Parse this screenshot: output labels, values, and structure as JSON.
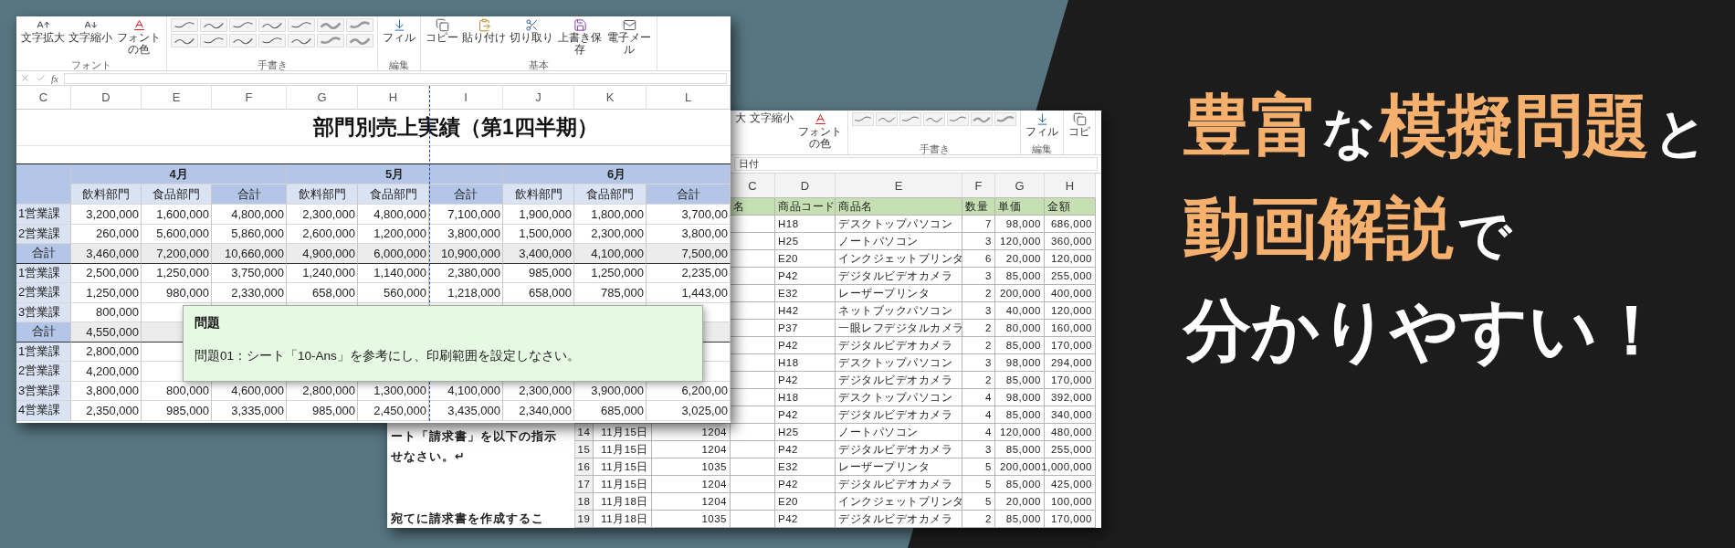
{
  "front_window": {
    "ribbon": {
      "groups": [
        {
          "kind": "tools",
          "label": "フォント",
          "tools": [
            {
              "label": "文字拡大",
              "kind": "grow"
            },
            {
              "label": "文字縮小",
              "kind": "shrink"
            },
            {
              "label": "フォントの色",
              "kind": "font_color"
            }
          ]
        },
        {
          "kind": "gallery",
          "label": "手書き"
        },
        {
          "kind": "tools",
          "label": "編集",
          "tools": [
            {
              "label": "フィル",
              "kind": "fill"
            }
          ]
        },
        {
          "kind": "tools",
          "label": "基本",
          "tools": [
            {
              "label": "コピー",
              "kind": "copy"
            },
            {
              "label": "貼り付け",
              "kind": "paste"
            },
            {
              "label": "切り取り",
              "kind": "cut"
            },
            {
              "label": "上書き保存",
              "kind": "save"
            },
            {
              "label": "電子メール",
              "kind": "mail"
            }
          ]
        }
      ]
    },
    "formula_bar": {
      "function_label": "fx"
    },
    "columns": [
      "C",
      "D",
      "E",
      "F",
      "G",
      "H",
      "I",
      "J",
      "K",
      "L"
    ],
    "title": "部門別売上実績（第1四半期）",
    "months": [
      {
        "label": "4月",
        "sub": [
          "飲料部門",
          "食品部門"
        ],
        "total": "合計"
      },
      {
        "label": "5月",
        "sub": [
          "飲料部門",
          "食品部門"
        ],
        "total": "合計"
      },
      {
        "label": "6月",
        "sub": [
          "飲料部門",
          "食品部門"
        ],
        "total": "合計"
      }
    ],
    "rows": [
      {
        "kind": "section",
        "label": "1営業課",
        "values": [
          "3,200,000",
          "1,600,000",
          "4,800,000",
          "2,300,000",
          "4,800,000",
          "7,100,000",
          "1,900,000",
          "1,800,000",
          "3,700,00"
        ]
      },
      {
        "kind": "section",
        "label": "2営業課",
        "values": [
          "260,000",
          "5,600,000",
          "5,860,000",
          "2,600,000",
          "1,200,000",
          "3,800,000",
          "1,500,000",
          "2,300,000",
          "3,800,00"
        ]
      },
      {
        "kind": "total",
        "label": "合計",
        "values": [
          "3,460,000",
          "7,200,000",
          "10,660,000",
          "4,900,000",
          "6,000,000",
          "10,900,000",
          "3,400,000",
          "4,100,000",
          "7,500,00"
        ]
      },
      {
        "kind": "section",
        "label": "1営業課",
        "values": [
          "2,500,000",
          "1,250,000",
          "3,750,000",
          "1,240,000",
          "1,140,000",
          "2,380,000",
          "985,000",
          "1,250,000",
          "2,235,00"
        ]
      },
      {
        "kind": "section",
        "label": "2営業課",
        "values": [
          "1,250,000",
          "980,000",
          "2,330,000",
          "658,000",
          "560,000",
          "1,218,000",
          "658,000",
          "785,000",
          "1,443,00"
        ]
      },
      {
        "kind": "section",
        "label": "3営業課",
        "values": [
          "800,000"
        ]
      },
      {
        "kind": "total",
        "label": "合計",
        "values": [
          "4,550,000"
        ]
      },
      {
        "kind": "section",
        "label": "1営業課",
        "values": [
          "2,800,000"
        ]
      },
      {
        "kind": "section",
        "label": "2営業課",
        "values": [
          "4,200,000"
        ]
      },
      {
        "kind": "section",
        "label": "3営業課",
        "values": [
          "3,800,000",
          "800,000",
          "4,600,000",
          "2,800,000",
          "1,300,000",
          "4,100,000",
          "2,300,000",
          "3,900,000",
          "6,200,00"
        ]
      },
      {
        "kind": "section",
        "label": "4営業課",
        "values": [
          "2,350,000",
          "985,000",
          "3,335,000",
          "985,000",
          "2,450,000",
          "3,435,000",
          "2,340,000",
          "685,000",
          "3,025,00"
        ]
      }
    ],
    "question": {
      "title": "問題",
      "text": "問題01：シート「10-Ans」を参考にし、印刷範囲を設定しなさい。"
    }
  },
  "back_window": {
    "document_lines": [
      "ート「請求書」を以下の指示",
      "せなさい。↵",
      "宛てに請求書を作成するこ"
    ],
    "ribbon": {
      "groups": [
        {
          "kind": "tools",
          "tools": [
            {
              "label": "大",
              "kind": "label"
            },
            {
              "label": "文字縮小",
              "kind": "label"
            },
            {
              "label": "フォントの色",
              "kind": "font_color"
            }
          ]
        },
        {
          "kind": "gallery",
          "label": "手書き"
        },
        {
          "kind": "tools",
          "label": "編集",
          "tools": [
            {
              "label": "フィル",
              "kind": "fill"
            }
          ]
        },
        {
          "kind": "tools",
          "tools": [
            {
              "label": "コピ",
              "kind": "copy"
            }
          ]
        }
      ]
    },
    "formula_value": "日付",
    "columns": [
      "C",
      "D",
      "E",
      "F",
      "G",
      "H"
    ],
    "header": {
      "store": "名",
      "code": "商品コード",
      "name": "商品名",
      "qty": "数量",
      "price": "単価",
      "amount": "金額"
    },
    "rows": [
      {
        "code": "H18",
        "name": "デスクトップパソコン",
        "qty": "7",
        "price": "98,000",
        "amount": "686,000"
      },
      {
        "code": "H25",
        "name": "ノートパソコン",
        "qty": "3",
        "price": "120,000",
        "amount": "360,000"
      },
      {
        "code": "E20",
        "name": "インクジェットプリンタ",
        "qty": "6",
        "price": "20,000",
        "amount": "120,000"
      },
      {
        "code": "P42",
        "name": "デジタルビデオカメラ",
        "qty": "3",
        "price": "85,000",
        "amount": "255,000"
      },
      {
        "code": "E32",
        "name": "レーザープリンタ",
        "qty": "2",
        "price": "200,000",
        "amount": "400,000"
      },
      {
        "code": "H42",
        "name": "ネットブックパソコン",
        "qty": "3",
        "price": "40,000",
        "amount": "120,000"
      },
      {
        "code": "P37",
        "name": "一眼レフデジタルカメラ",
        "qty": "2",
        "price": "80,000",
        "amount": "160,000"
      },
      {
        "code": "P42",
        "name": "デジタルビデオカメラ",
        "qty": "2",
        "price": "85,000",
        "amount": "170,000"
      },
      {
        "code": "H18",
        "name": "デスクトップパソコン",
        "qty": "3",
        "price": "98,000",
        "amount": "294,000"
      },
      {
        "code": "P42",
        "name": "デジタルビデオカメラ",
        "qty": "2",
        "price": "85,000",
        "amount": "170,000"
      },
      {
        "code": "H18",
        "name": "デスクトップパソコン",
        "qty": "4",
        "price": "98,000",
        "amount": "392,000"
      },
      {
        "code": "P42",
        "name": "デジタルビデオカメラ",
        "qty": "4",
        "price": "85,000",
        "amount": "340,000"
      },
      {
        "num": "14",
        "date": "11月15日",
        "id": "1204",
        "code": "H25",
        "name": "ノートパソコン",
        "qty": "4",
        "price": "120,000",
        "amount": "480,000"
      },
      {
        "num": "15",
        "date": "11月15日",
        "id": "1204",
        "code": "P42",
        "name": "デジタルビデオカメラ",
        "qty": "3",
        "price": "85,000",
        "amount": "255,000"
      },
      {
        "num": "16",
        "date": "11月15日",
        "id": "1035",
        "code": "E32",
        "name": "レーザープリンタ",
        "qty": "5",
        "price": "200,000",
        "amount": "1,000,000"
      },
      {
        "num": "17",
        "date": "11月15日",
        "id": "1204",
        "code": "P42",
        "name": "デジタルビデオカメラ",
        "qty": "5",
        "price": "85,000",
        "amount": "425,000"
      },
      {
        "num": "18",
        "date": "11月18日",
        "id": "1204",
        "code": "E20",
        "name": "インクジェットプリンタ",
        "qty": "5",
        "price": "20,000",
        "amount": "100,000"
      },
      {
        "num": "19",
        "date": "11月18日",
        "id": "1035",
        "code": "P42",
        "name": "デジタルビデオカメラ",
        "qty": "2",
        "price": "85,000",
        "amount": "170,000"
      }
    ]
  },
  "headline": {
    "lines": [
      {
        "kind": "mixed",
        "segments": [
          {
            "text": "豊富",
            "emphasis": true
          },
          {
            "text": "な",
            "emphasis": false
          },
          {
            "text": "模擬問題",
            "emphasis": true
          },
          {
            "text": "と",
            "emphasis": false
          }
        ]
      },
      {
        "kind": "mixed",
        "segments": [
          {
            "text": "動画解説",
            "emphasis": true
          },
          {
            "text": "で",
            "emphasis": false
          }
        ]
      },
      {
        "kind": "large",
        "segments": [
          {
            "text": "分かりやすい！",
            "emphasis": false
          }
        ]
      }
    ]
  }
}
